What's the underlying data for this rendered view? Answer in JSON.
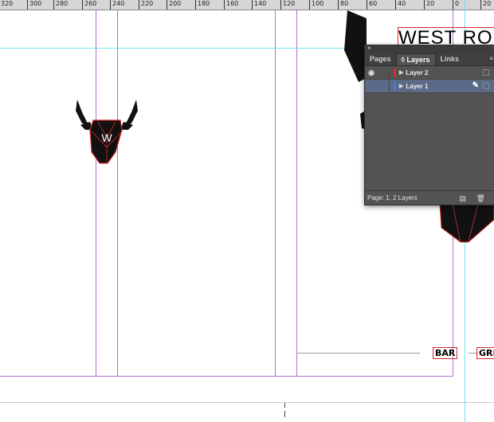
{
  "ruler": {
    "labels": [
      "320",
      "300",
      "280",
      "260",
      "240",
      "220",
      "200",
      "180",
      "160",
      "140",
      "120",
      "100",
      "80",
      "60",
      "40",
      "20",
      "0",
      "20"
    ]
  },
  "canvas": {
    "logo_letter": "W",
    "heading_text": "WEST RO",
    "bar_label": "BAR",
    "gri_label": "GRI"
  },
  "layers_panel": {
    "close_glyph": "×",
    "tabs": [
      {
        "label": "Pages"
      },
      {
        "label": "◊ Layers"
      },
      {
        "label": "Links"
      }
    ],
    "menu_glyph": "≡",
    "layers": [
      {
        "name": "Layer 2",
        "color": "#d42b2b"
      },
      {
        "name": "Layer 1",
        "color": "#4b7bd6"
      }
    ],
    "status": "Page: 1, 2 Layers",
    "new_layer_glyph": "▤",
    "delete_glyph": "🗑"
  }
}
